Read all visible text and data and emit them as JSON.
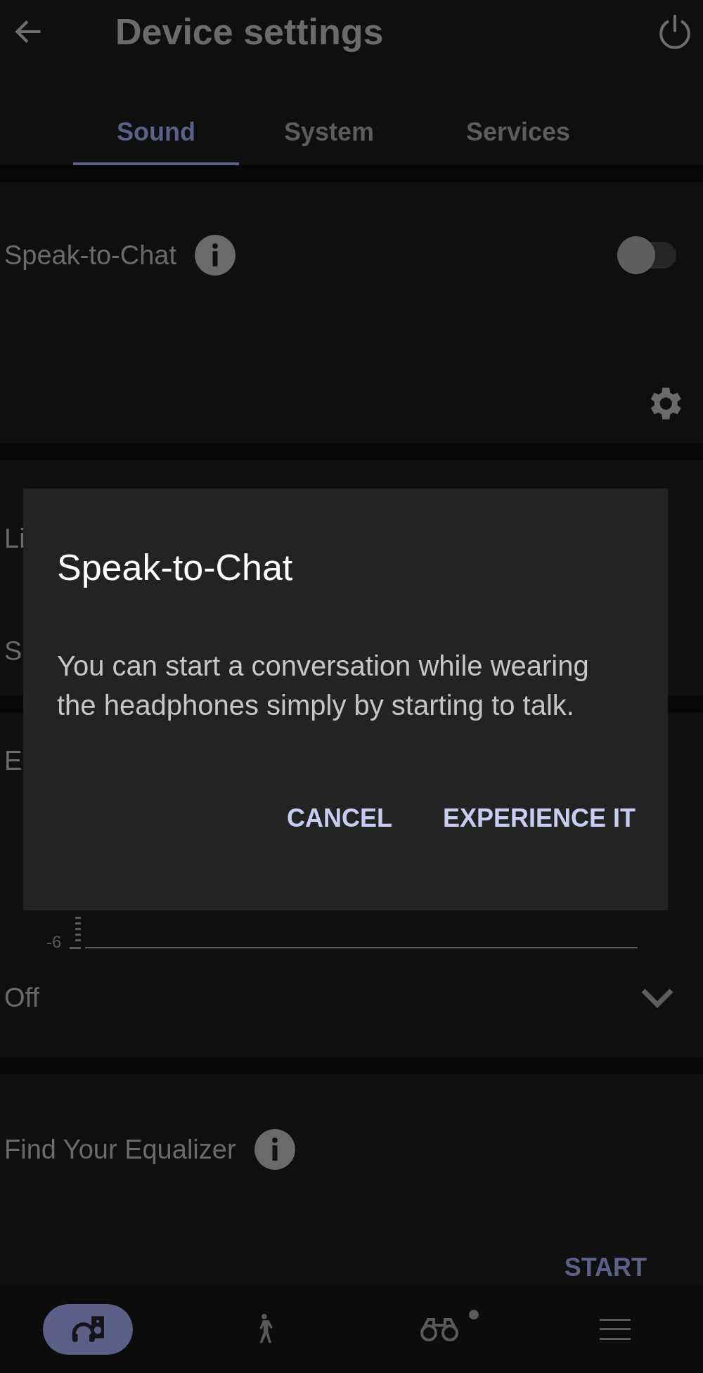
{
  "header": {
    "title": "Device settings"
  },
  "tabs": [
    {
      "label": "Sound",
      "selected": true
    },
    {
      "label": "System",
      "selected": false
    },
    {
      "label": "Services",
      "selected": false
    }
  ],
  "speak_to_chat": {
    "label": "Speak-to-Chat",
    "on": false
  },
  "hidden_card": {
    "line_1": "Li",
    "line_2": "S"
  },
  "equalizer": {
    "label": "E",
    "tick_label": "-6",
    "preset": "Off"
  },
  "find_equalizer": {
    "label": "Find Your Equalizer",
    "action": "START"
  },
  "bottom_nav": [
    {
      "kind": "sound",
      "selected": true,
      "dot": false
    },
    {
      "kind": "activity",
      "selected": false,
      "dot": false
    },
    {
      "kind": "discover",
      "selected": false,
      "dot": true
    },
    {
      "kind": "menu",
      "selected": false,
      "dot": false
    }
  ],
  "dialog": {
    "title": "Speak-to-Chat",
    "body": "You can start a conversation while wearing the headphones simply by starting to talk.",
    "buttons": [
      "CANCEL",
      "EXPERIENCE IT"
    ]
  }
}
